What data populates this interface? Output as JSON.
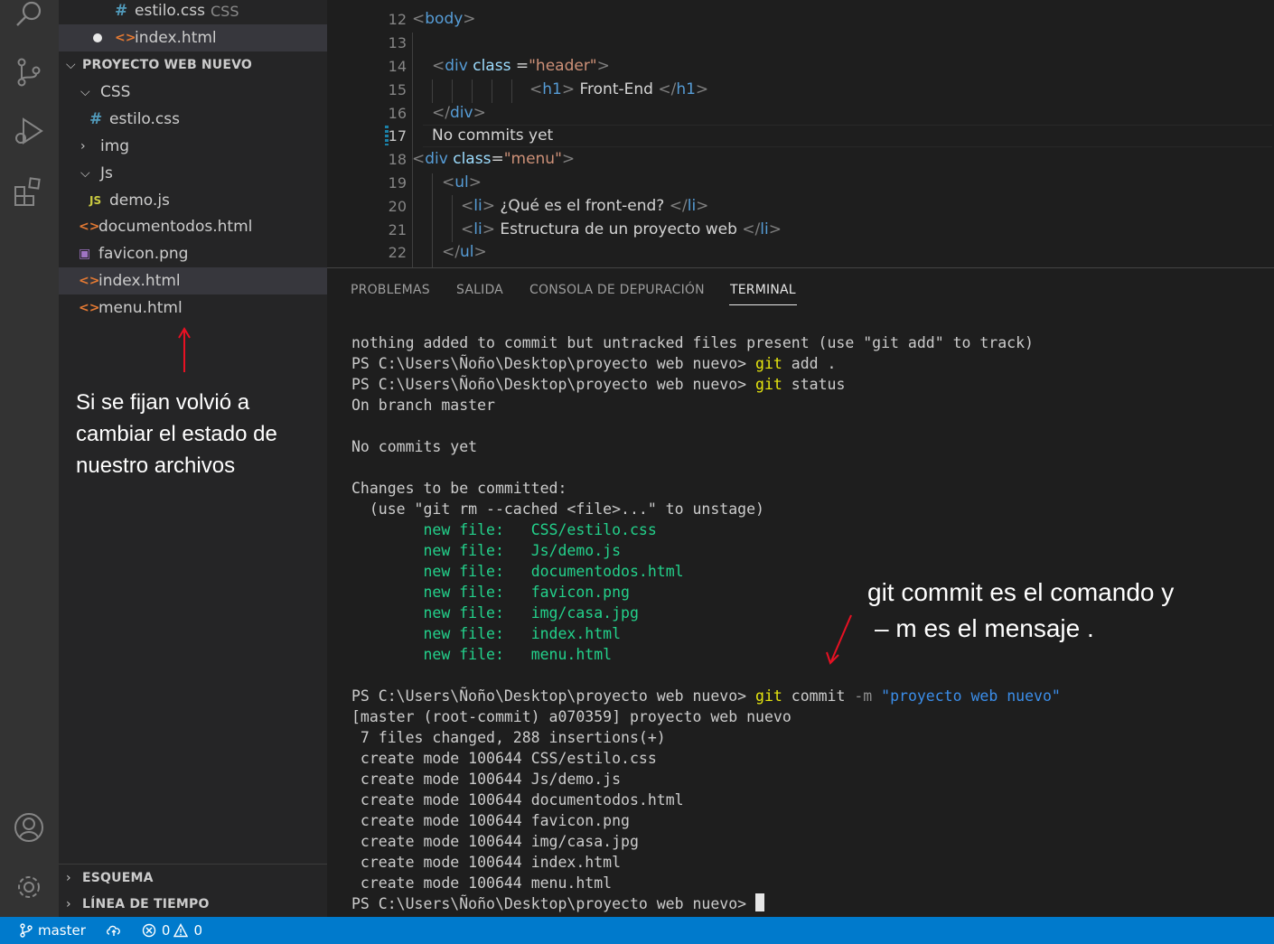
{
  "sidebar": {
    "open_editors": [
      {
        "name": "estilo.css",
        "hint": "CSS",
        "icon": "#"
      },
      {
        "name": "index.html",
        "icon": "<>"
      }
    ],
    "project_title": "PROYECTO WEB NUEVO",
    "tree": [
      {
        "label": "CSS",
        "type": "folder",
        "expanded": true
      },
      {
        "label": "estilo.css",
        "type": "css"
      },
      {
        "label": "img",
        "type": "folder",
        "expanded": false
      },
      {
        "label": "Js",
        "type": "folder",
        "expanded": true
      },
      {
        "label": "demo.js",
        "type": "js"
      },
      {
        "label": "documentodos.html",
        "type": "html"
      },
      {
        "label": "favicon.png",
        "type": "img"
      },
      {
        "label": "index.html",
        "type": "html"
      },
      {
        "label": "menu.html",
        "type": "html"
      }
    ],
    "icons": {
      "css": "#",
      "html": "<>",
      "js": "JS",
      "img": "▣"
    },
    "outline_label": "ESQUEMA",
    "timeline_label": "LÍNEA DE TIEMPO"
  },
  "annotations": {
    "left": "Si se fijan volvió a cambiar el estado de nuestro archivos",
    "right_line1": "git commit  es el comando y",
    "right_line2": "– m es el mensaje ."
  },
  "editor": {
    "line_numbers": [
      "12",
      "13",
      "14",
      "15",
      "16",
      "17",
      "18",
      "19",
      "20",
      "21",
      "22"
    ],
    "current_line": "17",
    "commit_text": "No commits yet",
    "body_tag": "body",
    "h1_text": " Front-End ",
    "li1": " ¿Qué es el front-end? ",
    "li2": " Estructura de un proyecto web ",
    "header_class": "\"header\"",
    "menu_class": "\"menu\""
  },
  "panel": {
    "tabs": [
      "PROBLEMAS",
      "SALIDA",
      "CONSOLA DE DEPURACIÓN",
      "TERMINAL"
    ],
    "active_tab": "TERMINAL",
    "prompt": "PS C:\\Users\\Ñoño\\Desktop\\proyecto web nuevo> ",
    "git": "git",
    "line_nothing_added": "nothing added to commit but untracked files present (use \"git add\" to track)",
    "cmd_add": " add .",
    "cmd_status": " status",
    "on_branch": "On branch master",
    "no_commits": "No commits yet",
    "changes": "Changes to be committed:",
    "unstage_hint": "  (use \"git rm --cached <file>...\" to unstage)",
    "new_file_label": "        new file:   ",
    "new_files": [
      "CSS/estilo.css",
      "Js/demo.js",
      "documentodos.html",
      "favicon.png",
      "img/casa.jpg",
      "index.html",
      "menu.html"
    ],
    "cmd_commit": " commit ",
    "flag_m": "-m",
    "commit_msg": "\"proyecto web nuevo\"",
    "commit_result": "[master (root-commit) a070359] proyecto web nuevo",
    "files_changed": " 7 files changed, 288 insertions(+)",
    "create_mode_prefix": " create mode 100644 ",
    "created_files": [
      "CSS/estilo.css",
      "Js/demo.js",
      "documentodos.html",
      "favicon.png",
      "img/casa.jpg",
      "index.html",
      "menu.html"
    ]
  },
  "statusbar": {
    "branch": "master",
    "errors": "0",
    "warnings": "0"
  },
  "colors": {
    "activity_bar": "#333333",
    "sidebar": "#252526",
    "editor_bg": "#1e1e1e",
    "status_bar": "#007acc",
    "terminal_green": "#23d18b",
    "terminal_yellow": "#e5e510",
    "annotation_arrow": "#e81123"
  }
}
